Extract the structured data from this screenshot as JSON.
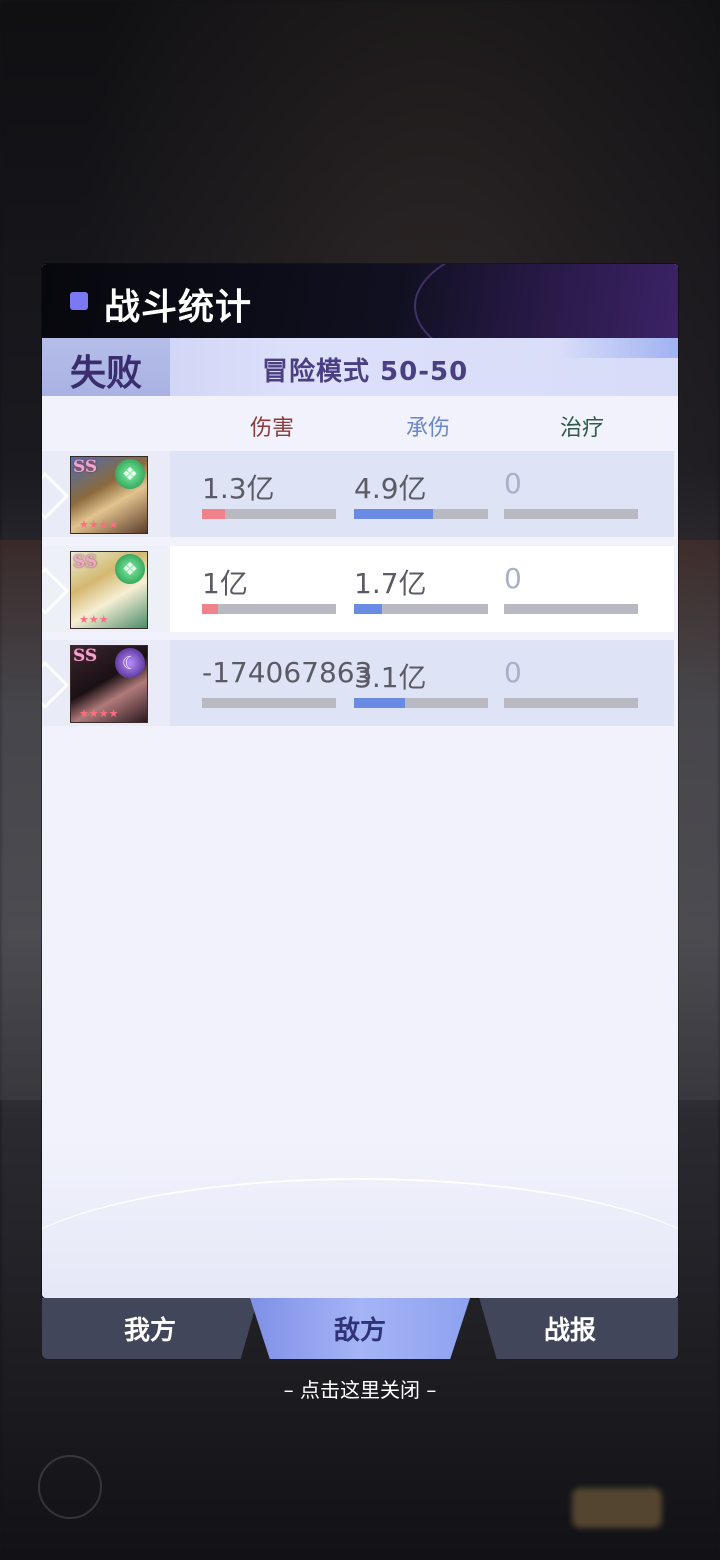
{
  "panel": {
    "title": "战斗统计",
    "result": "失败",
    "mode": "冒险模式 50-50"
  },
  "columns": {
    "damage": "伤害",
    "taken": "承伤",
    "heal": "治疗"
  },
  "rows": [
    {
      "grade": "SS",
      "element": "nature-gem-icon",
      "damage": "1.3亿",
      "damage_ratio": 0.17,
      "taken": "4.9亿",
      "taken_ratio": 0.59,
      "heal": "0",
      "heal_ratio": 0
    },
    {
      "grade": "SS",
      "element": "nature-gem-icon",
      "damage": "1亿",
      "damage_ratio": 0.12,
      "taken": "1.7亿",
      "taken_ratio": 0.21,
      "heal": "0",
      "heal_ratio": 0
    },
    {
      "grade": "SS",
      "element": "moon-gem-icon",
      "damage": "-174067863",
      "damage_ratio": 0,
      "taken": "3.1亿",
      "taken_ratio": 0.38,
      "heal": "0",
      "heal_ratio": 0
    }
  ],
  "tabs": {
    "ours": "我方",
    "enemy": "敌方",
    "report": "战报",
    "active": "enemy"
  },
  "close_hint": "– 点击这里关闭 –",
  "colors": {
    "damage_bar": "#f0828c",
    "taken_bar": "#6a8be3",
    "bar_track": "#b9bac1",
    "title_square": "#7a78f2"
  }
}
